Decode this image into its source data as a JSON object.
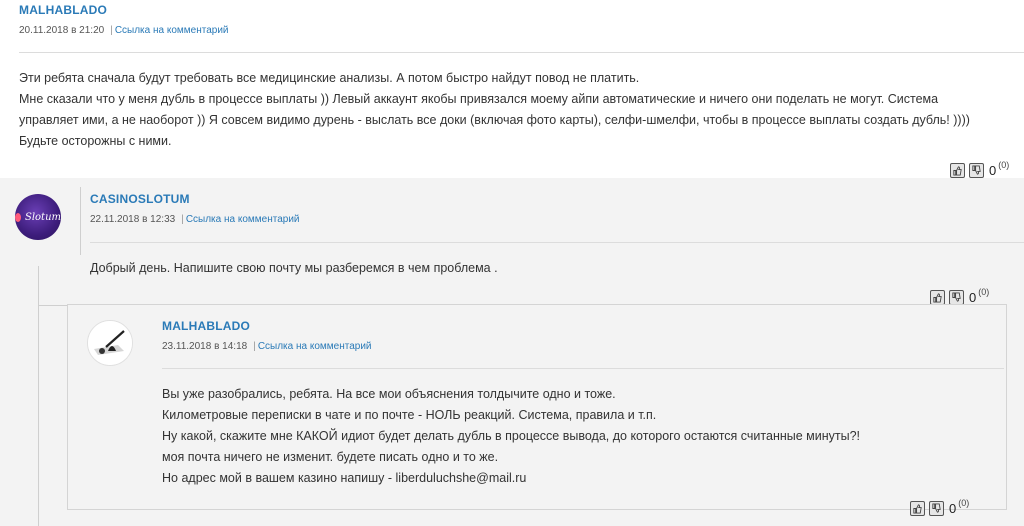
{
  "comments": [
    {
      "author": "MALHABLADO",
      "date": "20.11.2018 в 21:20",
      "link_label": "Ссылка на комментарий",
      "lines": [
        "Эти ребята сначала будут требовать все медицинские анализы. А потом быстро найдут повод не платить.",
        "Мне сказали что у меня дубль в процессе выплаты )) Левый аккаунт якобы привязался моему айпи автоматические и ничего они поделать не могут. Система",
        "управляет ими, а не наоборот )) Я совсем видимо дурень - выслать все доки (включая фото карты), селфи-шмелфи, чтобы в процессе выплаты создать дубль! ))))",
        "Будьте осторожны с ними."
      ],
      "rating": "0",
      "rating_total": "(0)"
    },
    {
      "author": "CASINOSLOTUM",
      "avatar_text": "Slotum",
      "date": "22.11.2018 в 12:33",
      "link_label": "Ссылка на комментарий",
      "lines": [
        "Добрый день. Напишите свою почту мы разберемся в чем проблема ."
      ],
      "rating": "0",
      "rating_total": "(0)"
    },
    {
      "author": "MALHABLADO",
      "date": "23.11.2018 в 14:18",
      "link_label": "Ссылка на комментарий",
      "lines": [
        "Вы уже разобрались, ребята. На все мои объяснения толдычите одно и тоже.",
        "Километровые переписки в чате и по почте - НОЛЬ реакций. Система, правила и т.п.",
        "Ну какой, скажите мне КАКОЙ идиот будет делать дубль в процессе вывода, до которого остаются считанные минуты?!",
        "моя почта ничего не изменит. будете писать одно и то же.",
        "Но адрес мой в вашем казино напишу - liberduluchshe@mail.ru"
      ],
      "rating": "0",
      "rating_total": "(0)"
    }
  ],
  "icons": {
    "like": "thumb-up-icon",
    "dislike": "thumb-down-icon"
  },
  "colors": {
    "author": "#2a7ab7",
    "link": "#2a7ab7",
    "page_bg": "#f3f3f3",
    "top_bg": "#ffffff",
    "avatar_slotum": "#3d1d7c"
  }
}
